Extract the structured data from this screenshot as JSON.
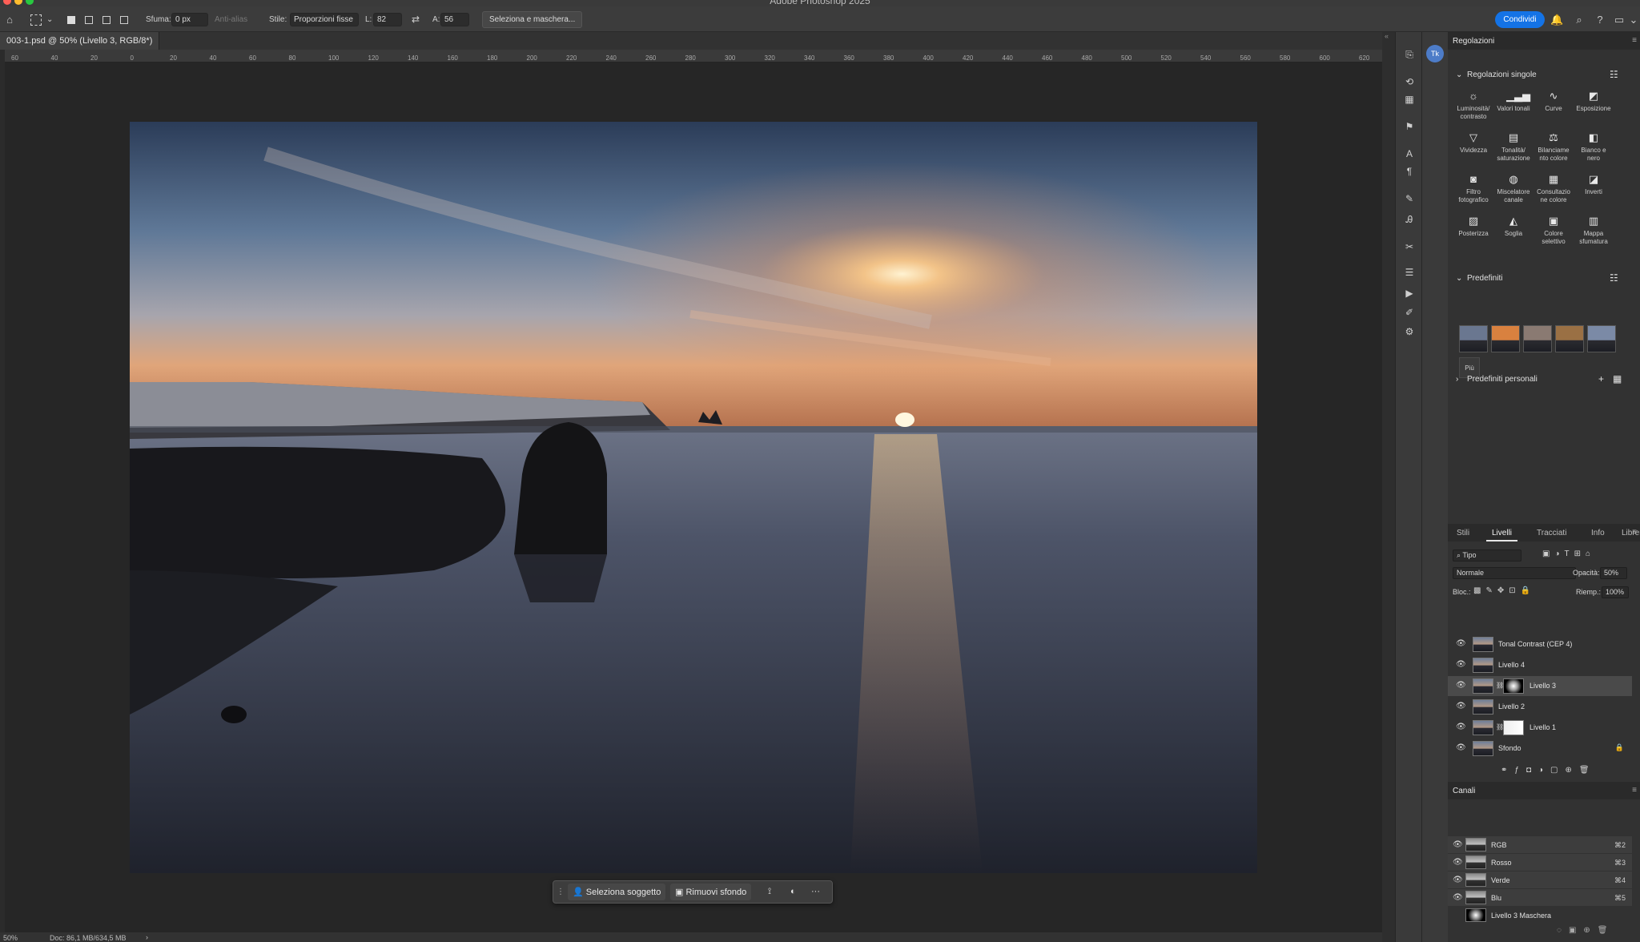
{
  "app": {
    "title": "Adobe Photoshop 2025"
  },
  "options_bar": {
    "feather_label": "Sfuma:",
    "feather_value": "0 px",
    "antialias_label": "Anti-alias",
    "style_label": "Stile:",
    "style_value": "Proporzioni fisse",
    "width_label": "L:",
    "width_value": "82",
    "height_label": "A:",
    "height_value": "56",
    "select_mask_label": "Seleziona e maschera...",
    "share_label": "Condividi"
  },
  "document": {
    "tab_label": "003-1.psd @ 50% (Livello 3, RGB/8*)",
    "zoom": "50%",
    "doc_info": "Doc: 86,1 MB/634,5 MB"
  },
  "ruler": {
    "ticks": [
      "60",
      "40",
      "20",
      "0",
      "20",
      "40",
      "60",
      "80",
      "100",
      "120",
      "140",
      "160",
      "180",
      "200",
      "220",
      "240",
      "260",
      "280",
      "300",
      "320",
      "340",
      "360",
      "380",
      "400",
      "420",
      "440",
      "460",
      "480",
      "500",
      "520",
      "540",
      "560",
      "580",
      "600",
      "620"
    ]
  },
  "taskbar": {
    "select_subject_label": "Seleziona soggetto",
    "remove_bg_label": "Rimuovi sfondo",
    "more_label": "···"
  },
  "adjustments": {
    "panel_title": "Regolazioni",
    "single_title": "Regolazioni singole",
    "items": [
      {
        "label": "Luminosità/ contrasto",
        "icon": "sun-icon"
      },
      {
        "label": "Valori tonali",
        "icon": "levels-icon"
      },
      {
        "label": "Curve",
        "icon": "curves-icon"
      },
      {
        "label": "Esposizione",
        "icon": "exposure-icon"
      },
      {
        "label": "Vividezza",
        "icon": "vibrance-icon"
      },
      {
        "label": "Tonalità/ saturazione",
        "icon": "hue-icon"
      },
      {
        "label": "Bilanciame nto colore",
        "icon": "balance-icon"
      },
      {
        "label": "Bianco e nero",
        "icon": "bw-icon"
      },
      {
        "label": "Filtro fotografico",
        "icon": "photo-filter-icon"
      },
      {
        "label": "Miscelatore canale",
        "icon": "channel-mixer-icon"
      },
      {
        "label": "Consultazio ne colore",
        "icon": "color-lookup-icon"
      },
      {
        "label": "Inverti",
        "icon": "invert-icon"
      },
      {
        "label": "Posterizza",
        "icon": "posterize-icon"
      },
      {
        "label": "Soglia",
        "icon": "threshold-icon"
      },
      {
        "label": "Colore selettivo",
        "icon": "selective-color-icon"
      },
      {
        "label": "Mappa sfumatura",
        "icon": "gradient-map-icon"
      }
    ],
    "presets_title": "Predefiniti",
    "more_label": "Più",
    "personal_title": "Predefiniti personali"
  },
  "layers_panel": {
    "tabs": [
      "Stili",
      "Livelli",
      "Tracciati",
      "Info",
      "Librerie"
    ],
    "active_tab": "Livelli",
    "filter_label": "Tipo",
    "blend_mode": "Normale",
    "opacity_label": "Opacità:",
    "opacity_value": "50%",
    "lock_label": "Bloc.:",
    "fill_label": "Riemp.:",
    "fill_value": "100%",
    "layers": [
      {
        "name": "Tonal Contrast (CEP 4)",
        "mask": false,
        "selected": false
      },
      {
        "name": "Livello 4",
        "mask": false,
        "selected": false
      },
      {
        "name": "Livello 3",
        "mask": true,
        "selected": true
      },
      {
        "name": "Livello 2",
        "mask": false,
        "selected": false
      },
      {
        "name": "Livello 1",
        "mask": true,
        "selected": false
      },
      {
        "name": "Sfondo",
        "mask": false,
        "selected": false,
        "locked": true
      }
    ]
  },
  "channels_panel": {
    "title": "Canali",
    "channels": [
      {
        "name": "RGB",
        "shortcut": "⌘2"
      },
      {
        "name": "Rosso",
        "shortcut": "⌘3"
      },
      {
        "name": "Verde",
        "shortcut": "⌘4"
      },
      {
        "name": "Blu",
        "shortcut": "⌘5"
      },
      {
        "name": "Livello 3 Maschera",
        "shortcut": ""
      }
    ]
  },
  "colors": {
    "accent": "#1473e6",
    "panel": "#323232",
    "canvas": "#262626"
  }
}
